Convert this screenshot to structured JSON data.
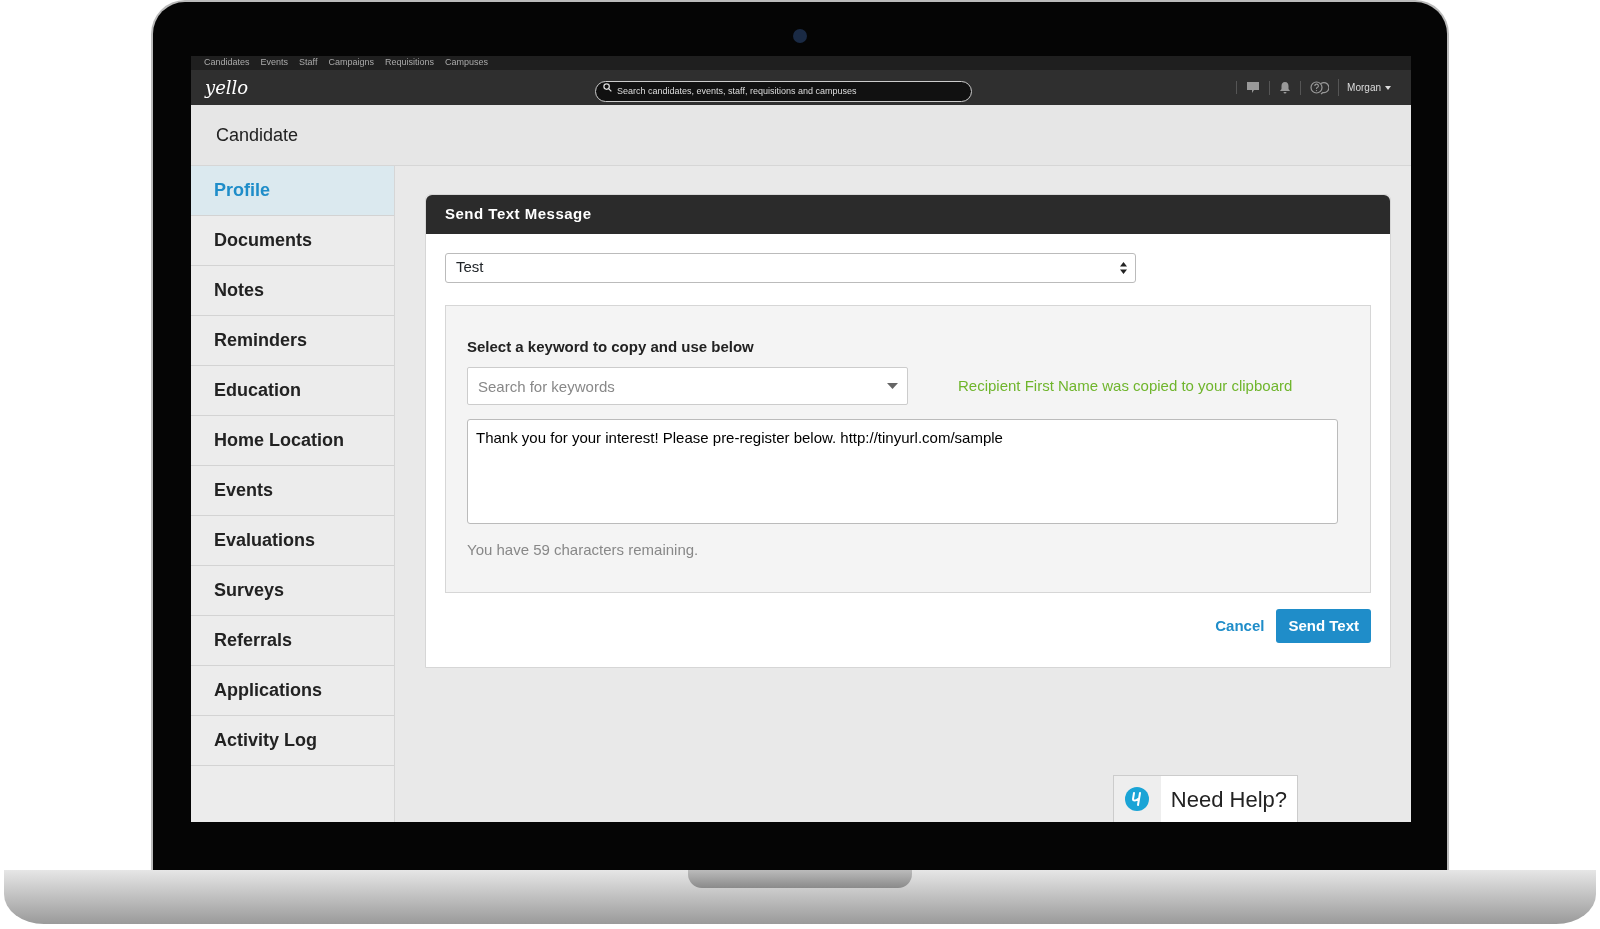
{
  "top_nav": {
    "links": [
      {
        "label": "Candidates"
      },
      {
        "label": "Events"
      },
      {
        "label": "Staff"
      },
      {
        "label": "Campaigns"
      },
      {
        "label": "Requisitions"
      },
      {
        "label": "Campuses"
      }
    ]
  },
  "header": {
    "logo": "yello",
    "search": {
      "placeholder": "Search candidates, events, staff, requisitions and campuses"
    },
    "user": "Morgan"
  },
  "page_title": "Candidate",
  "sidebar": {
    "items": [
      {
        "label": "Profile",
        "selected": true
      },
      {
        "label": "Documents",
        "selected": false
      },
      {
        "label": "Notes",
        "selected": false
      },
      {
        "label": "Reminders",
        "selected": false
      },
      {
        "label": "Education",
        "selected": false
      },
      {
        "label": "Home Location",
        "selected": false
      },
      {
        "label": "Events",
        "selected": false
      },
      {
        "label": "Evaluations",
        "selected": false
      },
      {
        "label": "Surveys",
        "selected": false
      },
      {
        "label": "Referrals",
        "selected": false
      },
      {
        "label": "Applications",
        "selected": false
      },
      {
        "label": "Activity Log",
        "selected": false
      }
    ]
  },
  "dialog": {
    "title": "Send Text Message",
    "template": {
      "value": "Test"
    },
    "keyword_label": "Select a keyword to copy and use below",
    "keyword_search": {
      "placeholder": "Search for keywords"
    },
    "copy_notice": "Recipient First Name was copied to your clipboard",
    "message": {
      "value": "Thank you for your interest! Please pre-register below. http://tinyurl.com/sample"
    },
    "remaining": "You have 59 characters remaining.",
    "cancel": "Cancel",
    "send": "Send Text"
  },
  "help": {
    "label": "Need Help?"
  }
}
